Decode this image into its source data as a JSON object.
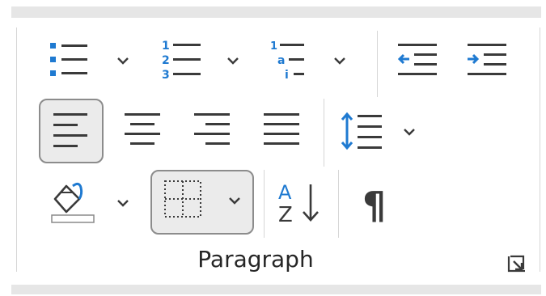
{
  "group": {
    "label": "Paragraph",
    "numbering": {
      "digits": [
        "1",
        "2",
        "3"
      ]
    },
    "multilevel": {
      "marks": [
        "1",
        "a",
        "i"
      ]
    },
    "sort": {
      "letters": [
        "A",
        "Z"
      ]
    },
    "show_marks": {
      "glyph": "¶"
    }
  },
  "colors": {
    "accent": "#1f7ad1",
    "icon": "#3a3a3a",
    "active_bg": "#ebebeb",
    "active_border": "#8c8c8c",
    "divider": "#d6d6d6"
  }
}
